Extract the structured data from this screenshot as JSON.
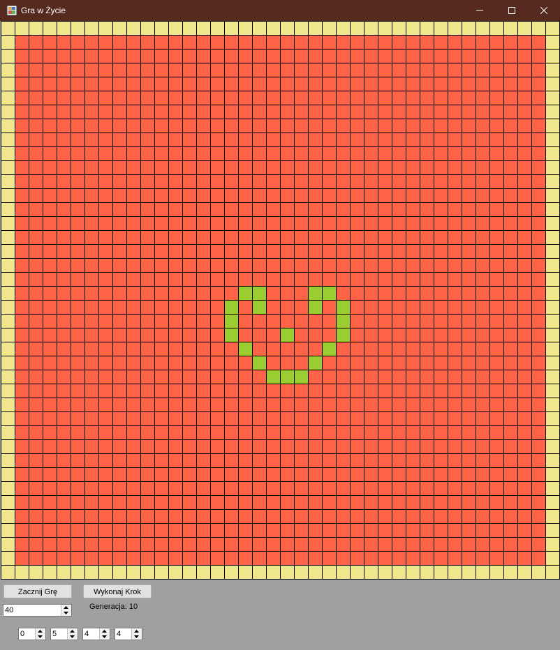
{
  "window": {
    "title": "Gra w Życie",
    "icon": "app-icon",
    "controls": [
      "minimize-icon",
      "maximize-icon",
      "close-icon"
    ]
  },
  "board": {
    "rows": 40,
    "cols": 40,
    "colors": {
      "border_cell": "#f0e68c",
      "dead_cell": "#ff6347",
      "alive_cell": "#9acd32",
      "grid_line": "#000000"
    },
    "alive_cells": [
      [
        19,
        17
      ],
      [
        19,
        18
      ],
      [
        19,
        22
      ],
      [
        19,
        23
      ],
      [
        20,
        16
      ],
      [
        20,
        18
      ],
      [
        20,
        22
      ],
      [
        20,
        24
      ],
      [
        21,
        16
      ],
      [
        21,
        24
      ],
      [
        22,
        16
      ],
      [
        22,
        20
      ],
      [
        22,
        24
      ],
      [
        23,
        17
      ],
      [
        23,
        23
      ],
      [
        24,
        18
      ],
      [
        24,
        22
      ],
      [
        25,
        19
      ],
      [
        25,
        20
      ],
      [
        25,
        21
      ]
    ]
  },
  "controls": {
    "start_button": "Zacznij Grę",
    "step_button": "Wykonaj Krok",
    "size_value": "40",
    "generation_label": "Generacja: 10",
    "rule_values": [
      "0",
      "5",
      "4",
      "4"
    ]
  }
}
